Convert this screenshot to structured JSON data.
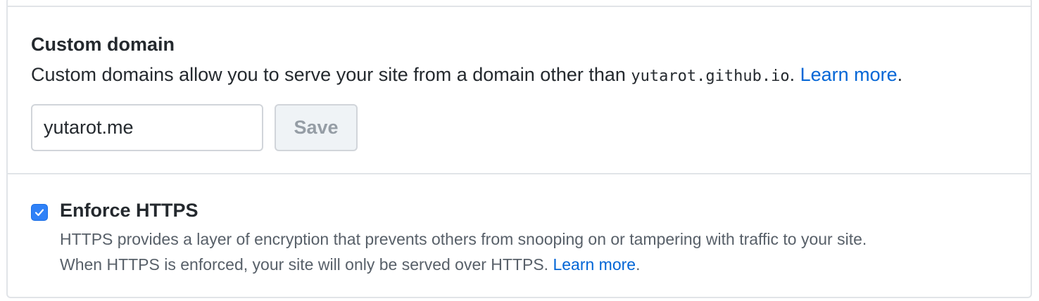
{
  "custom_domain": {
    "heading": "Custom domain",
    "description_before": "Custom domains allow you to serve your site from a domain other than ",
    "description_code": "yutarot.github.io",
    "description_after": ". ",
    "learn_more": "Learn more",
    "learn_more_suffix": ".",
    "input_value": "yutarot.me",
    "save_label": "Save"
  },
  "enforce_https": {
    "checked": true,
    "title": "Enforce HTTPS",
    "description_line1": "HTTPS provides a layer of encryption that prevents others from snooping on or tampering with traffic to your site.",
    "description_line2": "When HTTPS is enforced, your site will only be served over HTTPS. ",
    "learn_more": "Learn more",
    "learn_more_suffix": "."
  },
  "colors": {
    "link": "#0366d6",
    "checkbox": "#2f81f7",
    "border": "#e1e4e8",
    "button_bg": "#eff3f6",
    "button_text": "#959da5"
  }
}
